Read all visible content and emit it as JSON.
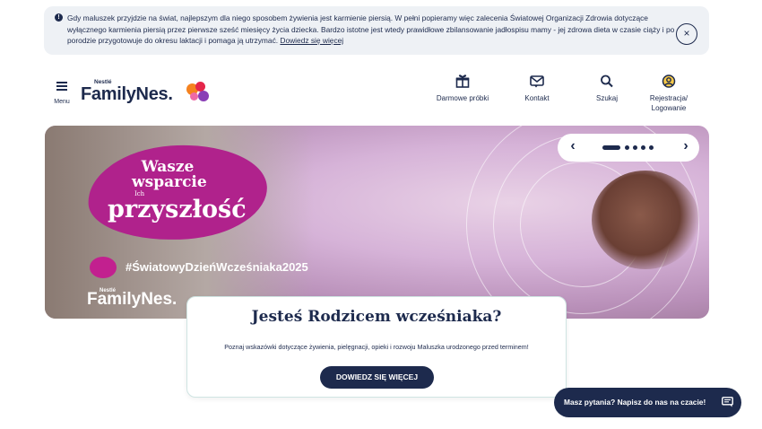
{
  "notice": {
    "text": "Gdy maluszek przyjdzie na świat, najlepszym dla niego sposobem żywienia jest karmienie piersią. W pełni popieramy więc zalecenia Światowej Organizacji Zdrowia dotyczące wyłącznego karmienia piersią przez pierwsze sześć miesięcy życia dziecka. Bardzo istotne jest wtedy prawidłowe zbilansowanie jadłospisu mamy - jej zdrowa dieta w czasie ciąży i po porodzie przygotowuje do okresu laktacji i pomaga ją utrzymać.",
    "link": "Dowiedz się więcej",
    "close": "×",
    "info": "!"
  },
  "header": {
    "menu_label": "Menu",
    "logo_brand": "Nestlé",
    "logo_text": "FamilyNes.",
    "nav": [
      {
        "label": "Darmowe próbki",
        "icon": "gift-icon"
      },
      {
        "label": "Kontakt",
        "icon": "mail-icon"
      },
      {
        "label": "Szukaj",
        "icon": "search-icon"
      },
      {
        "label": "Rejestracja/ Logowanie",
        "icon": "user-icon"
      }
    ]
  },
  "hero": {
    "headline_1": "Wasze wsparcie",
    "headline_small": "Ich",
    "headline_2": "przyszłość",
    "hashtag": "#ŚwiatowyDzieńWcześniaka2025",
    "logo_brand": "Nestlé",
    "logo_text": "FamilyNes.",
    "slider": {
      "prev": "‹",
      "next": "›",
      "total": 5,
      "active": 1
    }
  },
  "card": {
    "title": "Jesteś Rodzicem wcześniaka?",
    "description": "Poznaj wskazówki dotyczące żywienia, pielęgnacji, opieki i rozwoju Maluszka urodzonego przed terminem!",
    "button": "DOWIEDZ SIĘ WIĘCEJ"
  },
  "chat": {
    "label": "Masz pytania? Napisz do nas na czacie!",
    "icon": "chat-icon"
  },
  "colors": {
    "navy": "#1d2a4d",
    "magenta": "#b0228c",
    "notice_bg": "#eef1f5"
  }
}
